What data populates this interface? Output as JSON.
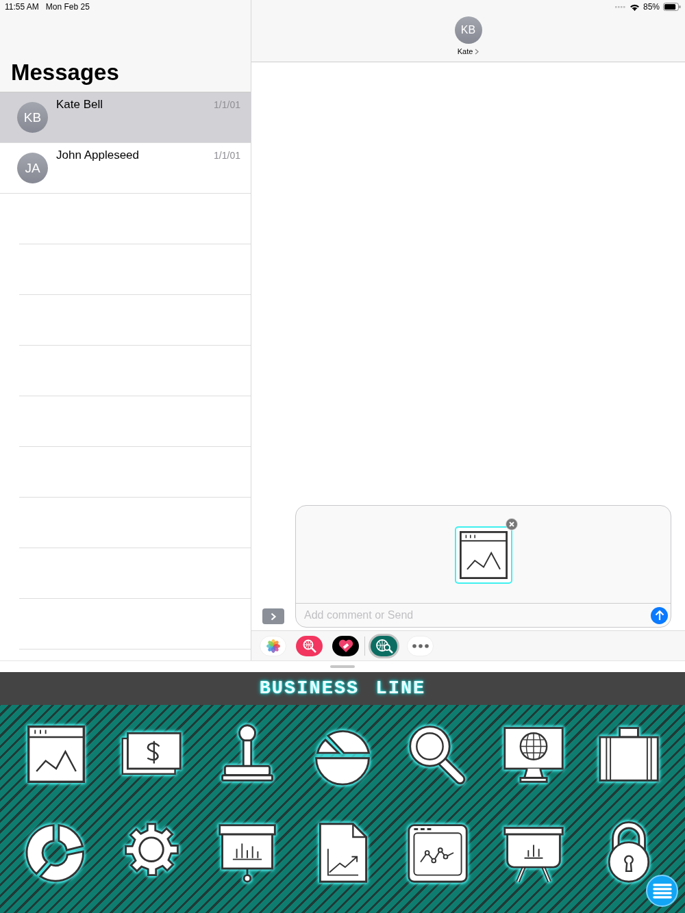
{
  "status_bar": {
    "time": "11:55 AM",
    "date": "Mon Feb 25",
    "battery": "85%"
  },
  "sidebar": {
    "title": "Messages",
    "conversations": [
      {
        "initials": "KB",
        "name": "Kate Bell",
        "date": "1/1/01",
        "selected": true
      },
      {
        "initials": "JA",
        "name": "John Appleseed",
        "date": "1/1/01",
        "selected": false
      }
    ]
  },
  "chat_header": {
    "initials": "KB",
    "name": "Kate"
  },
  "composer": {
    "attachment": {
      "kind": "window-chart"
    },
    "placeholder": "Add comment or Send"
  },
  "app_drawer": [
    {
      "kind": "photos",
      "selected": false
    },
    {
      "kind": "search",
      "selected": false
    },
    {
      "kind": "heart",
      "selected": false
    },
    {
      "kind": "globe",
      "selected": true
    },
    {
      "kind": "more",
      "selected": false
    }
  ],
  "sticker_pack": {
    "title": "BUSINESS LINE",
    "stickers": [
      {
        "kind": "window-chart"
      },
      {
        "kind": "money"
      },
      {
        "kind": "stamp"
      },
      {
        "kind": "pie-chart"
      },
      {
        "kind": "magnifier"
      },
      {
        "kind": "monitor-globe"
      },
      {
        "kind": "briefcase"
      },
      {
        "kind": "donut-chart"
      },
      {
        "kind": "gear"
      },
      {
        "kind": "presentation-board"
      },
      {
        "kind": "document-chart"
      },
      {
        "kind": "browser-chart"
      },
      {
        "kind": "easel-chart"
      },
      {
        "kind": "padlock"
      }
    ]
  }
}
